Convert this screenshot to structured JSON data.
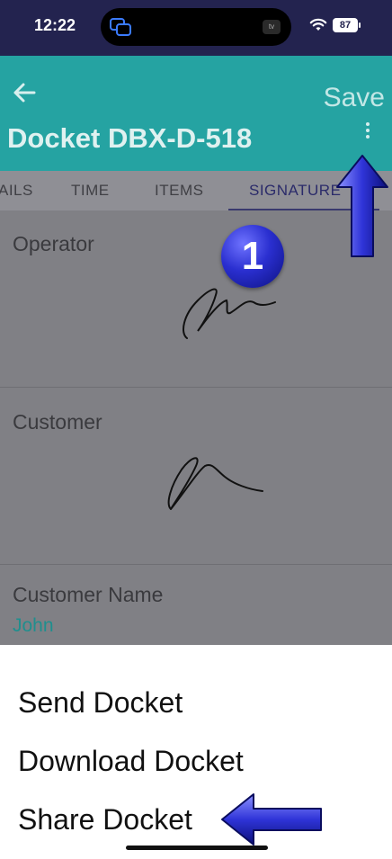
{
  "status_bar": {
    "time": "12:22",
    "battery": "87"
  },
  "app_bar": {
    "save_label": "Save",
    "title": "Docket DBX-D-518"
  },
  "tabs": [
    {
      "label": "AILS"
    },
    {
      "label": "TIME"
    },
    {
      "label": "ITEMS"
    },
    {
      "label": "SIGNATURE"
    }
  ],
  "sections": {
    "operator_label": "Operator",
    "customer_label": "Customer",
    "customer_name_label": "Customer Name",
    "customer_name_value": "John"
  },
  "annotation": {
    "badge_number": "1"
  },
  "menu": {
    "items": [
      {
        "label": "Send Docket"
      },
      {
        "label": "Download Docket"
      },
      {
        "label": "Share Docket"
      }
    ]
  },
  "colors": {
    "status_bar": "#23234f",
    "app_bar": "#25a3a2",
    "tab_active_underline": "#3a3a6e",
    "customer_name_text": "#1f8f8e",
    "annotation_blue": "#2a2fd0"
  },
  "icons": {
    "back": "arrow-left-icon",
    "overflow": "kebab-menu-icon",
    "wifi": "wifi-icon"
  }
}
